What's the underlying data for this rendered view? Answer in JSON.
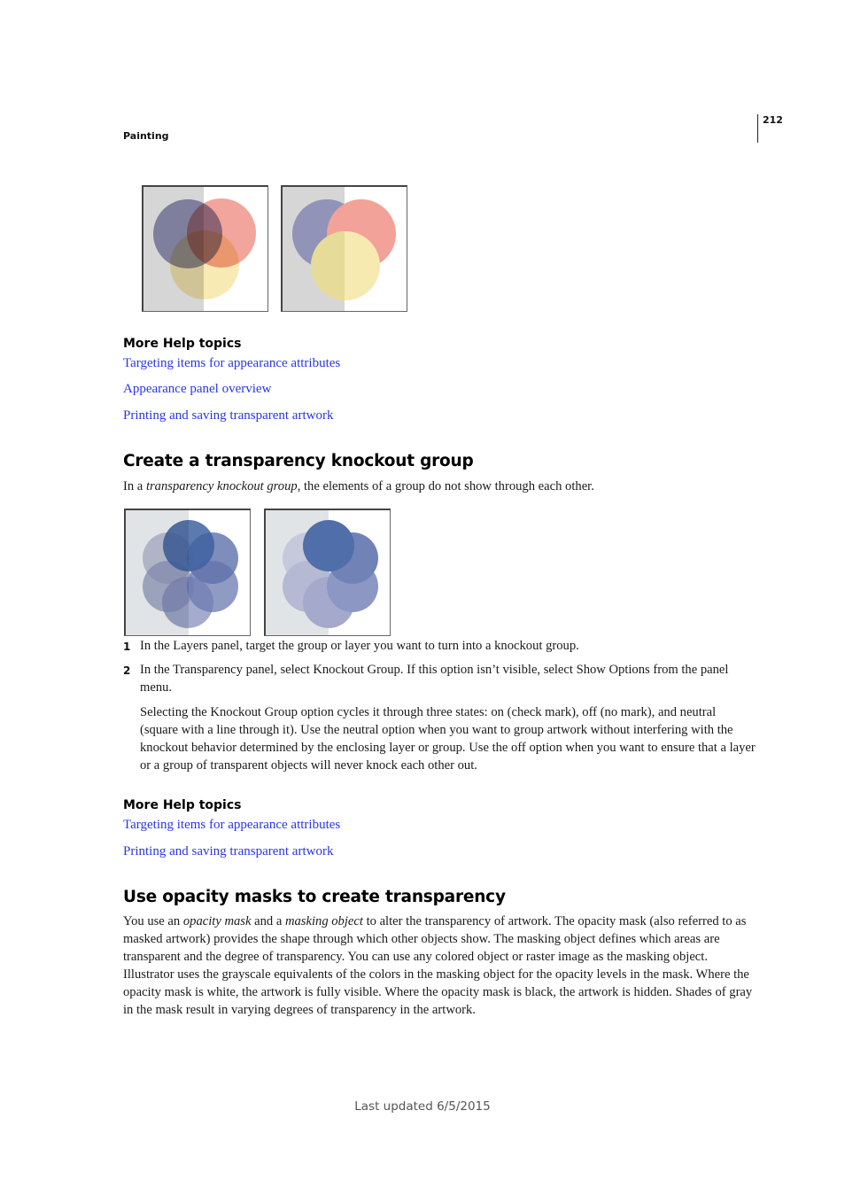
{
  "header": {
    "section": "Painting",
    "page_number": "212"
  },
  "figures": {
    "fig1": {
      "left_label": "overlapping transparent circles (normal)",
      "right_label": "overlapping transparent circles (knockout)",
      "colors": {
        "gray": "#d6d6d6",
        "blue": "#9193b8",
        "red": "#f2a298",
        "yellow": "#f7eab0"
      }
    },
    "fig2": {
      "left_label": "flower of transparent blue circles (normal)",
      "right_label": "flower of transparent blue circles (knockout)",
      "colors": {
        "gray": "#e1e4e6",
        "blue": "#4f6eaa"
      }
    }
  },
  "help1": {
    "title": "More Help topics",
    "links": [
      "Targeting items for appearance attributes",
      "Appearance panel overview",
      "Printing and saving transparent artwork"
    ]
  },
  "section1": {
    "heading": "Create a transparency knockout group",
    "intro": {
      "before": "In a ",
      "italic": "transparency knockout group",
      "after": ", the elements of a group do not show through each other."
    },
    "steps": [
      {
        "num": "1",
        "text": "In the Layers panel, target the group or layer you want to turn into a knockout group."
      },
      {
        "num": "2",
        "text": "In the Transparency panel, select Knockout Group. If this option isn’t visible, select Show Options from the panel menu."
      }
    ],
    "note": "Selecting the Knockout Group option cycles it through three states: on (check mark), off (no mark), and neutral (square with a line through it). Use the neutral option when you want to group artwork without interfering with the knockout behavior determined by the enclosing layer or group. Use the off option when you want to ensure that a layer or a group of transparent objects will never knock each other out."
  },
  "help2": {
    "title": "More Help topics",
    "links": [
      "Targeting items for appearance attributes",
      "Printing and saving transparent artwork"
    ]
  },
  "section2": {
    "heading": "Use opacity masks to create transparency",
    "para": {
      "p1": "You use an ",
      "i1": "opacity mask",
      "p2": " and a ",
      "i2": "masking object",
      "p3": " to alter the transparency of artwork. The opacity mask (also referred to as masked artwork) provides the shape through which other objects show. The masking object defines which areas are transparent and the degree of transparency. You can use any colored object or raster image as the masking object. Illustrator uses the grayscale equivalents of the colors in the masking object for the opacity levels in the mask. Where the opacity mask is white, the artwork is fully visible. Where the opacity mask is black, the artwork is hidden. Shades of gray in the mask result in varying degrees of transparency in the artwork."
    }
  },
  "footer": {
    "text": "Last updated 6/5/2015"
  }
}
